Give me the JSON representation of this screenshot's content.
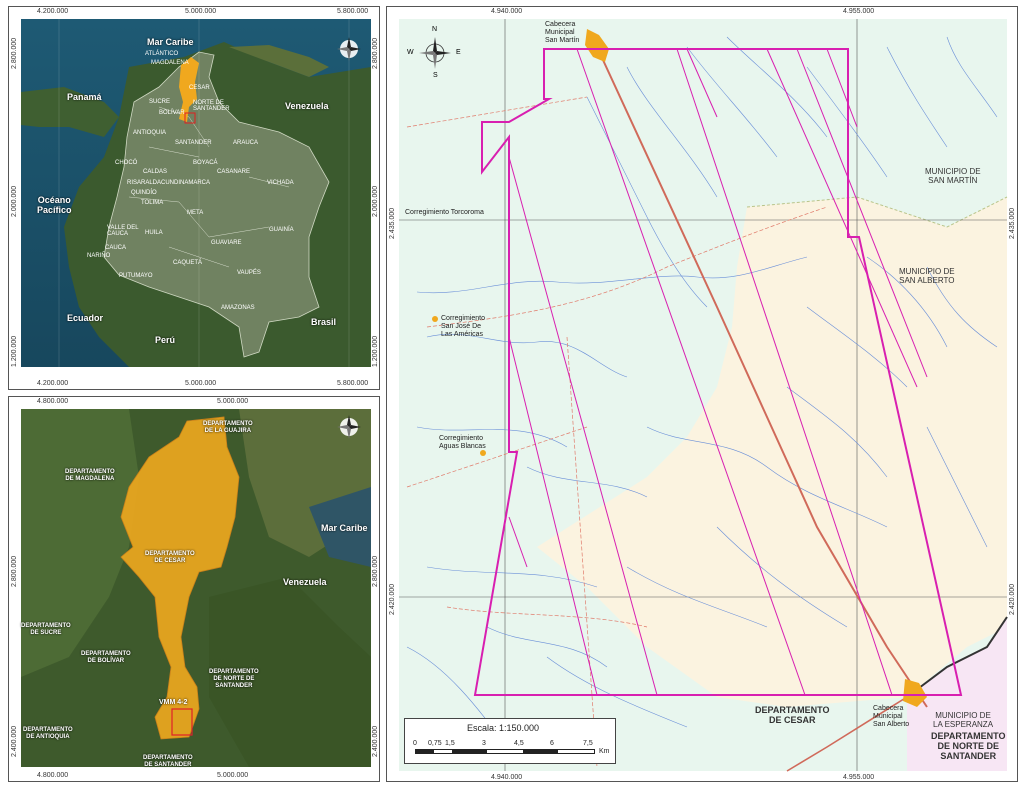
{
  "inset_colombia": {
    "x_ticks": [
      "4.200.000",
      "5.000.000",
      "5.800.000"
    ],
    "y_ticks": [
      "2.800.000",
      "2.000.000",
      "1.200.000"
    ],
    "labels": {
      "caribbean": "Mar Caribe",
      "panama": "Panamá",
      "venezuela": "Venezuela",
      "pacific": "Océano\nPacífico",
      "ecuador": "Ecuador",
      "peru": "Perú",
      "brasil": "Brasil"
    },
    "departments": [
      "ATLÁNTICO",
      "MAGDALENA",
      "CESAR",
      "SUCRE",
      "BOLÍVAR",
      "NORTE DE SANTANDER",
      "ANTIOQUIA",
      "SANTANDER",
      "ARAUCA",
      "CHOCÓ",
      "CALDAS",
      "BOYACÁ",
      "CASANARE",
      "RISARALDA",
      "QUINDÍO",
      "CUNDINAMARCA",
      "VICHADA",
      "TOLIMA",
      "META",
      "VALLE DEL CAUCA",
      "HUILA",
      "CAUCA",
      "GUAVIARE",
      "GUAINÍA",
      "NARIÑO",
      "CAQUETÁ",
      "VAUPÉS",
      "PUTUMAYO",
      "AMAZONAS"
    ]
  },
  "inset_region": {
    "x_ticks": [
      "4.800.000",
      "5.000.000"
    ],
    "y_ticks": [
      "2.800.000",
      "2.400.000"
    ],
    "labels": {
      "la_guajira": "DEPARTAMENTO\nDE LA GUAJIRA",
      "magdalena": "DEPARTAMENTO\nDE MAGDALENA",
      "cesar": "DEPARTAMENTO\nDE CESAR",
      "caribbean": "Mar Caribe",
      "venezuela": "Venezuela",
      "sucre": "DEPARTAMENTO\nDE SUCRE",
      "bolivar": "DEPARTAMENTO\nDE BOLÍVAR",
      "norte_santander": "DEPARTAMENTO\nDE NORTE DE\nSANTANDER",
      "antioquia": "DEPARTAMENTO\nDE ANTIOQUIA",
      "santander": "DEPARTAMENTO\nDE SANTANDER",
      "block": "VMM 4-2"
    }
  },
  "main_map": {
    "x_ticks": [
      "4.940.000",
      "4.955.000"
    ],
    "y_ticks": [
      "2.435.000",
      "2.420.000"
    ],
    "places": {
      "san_martin_cabecera": "Cabecera\nMunicipal\nSan Martín",
      "torcoroma": "Corregimiento Torcoroma",
      "san_jose": "Corregimiento\nSan José De\nLas Américas",
      "aguas_blancas": "Corregimiento\nAguas Blancas",
      "san_alberto_cabecera": "Cabecera\nMunicipal\nSan Alberto"
    },
    "municipalities": {
      "san_martin": "MUNICIPIO DE\nSAN MARTÍN",
      "san_alberto": "MUNICIPIO DE\nSAN ALBERTO",
      "la_esperanza": "MUNICIPIO DE\nLA ESPERANZA"
    },
    "departments": {
      "cesar": "DEPARTAMENTO\nDE CESAR",
      "norte_santander": "DEPARTAMENTO\nDE NORTE DE\nSANTANDER"
    },
    "scale": {
      "title": "Escala: 1:150.000",
      "ticks": [
        "0",
        "0,75",
        "1,5",
        "3",
        "4,5",
        "6",
        "7,5"
      ],
      "unit": "Km"
    },
    "compass": {
      "n": "N",
      "s": "S",
      "e": "E",
      "w": "W"
    }
  },
  "colors": {
    "block_outline": "#d81fb0",
    "block_fill": "#f0a81e",
    "rivers": "#6a8fd8",
    "roads": "#e07a6a",
    "cesar_bg": "#e8f6ee",
    "san_alberto_bg": "#fbf3e0",
    "norte_santander_bg": "#f7e6f4"
  }
}
